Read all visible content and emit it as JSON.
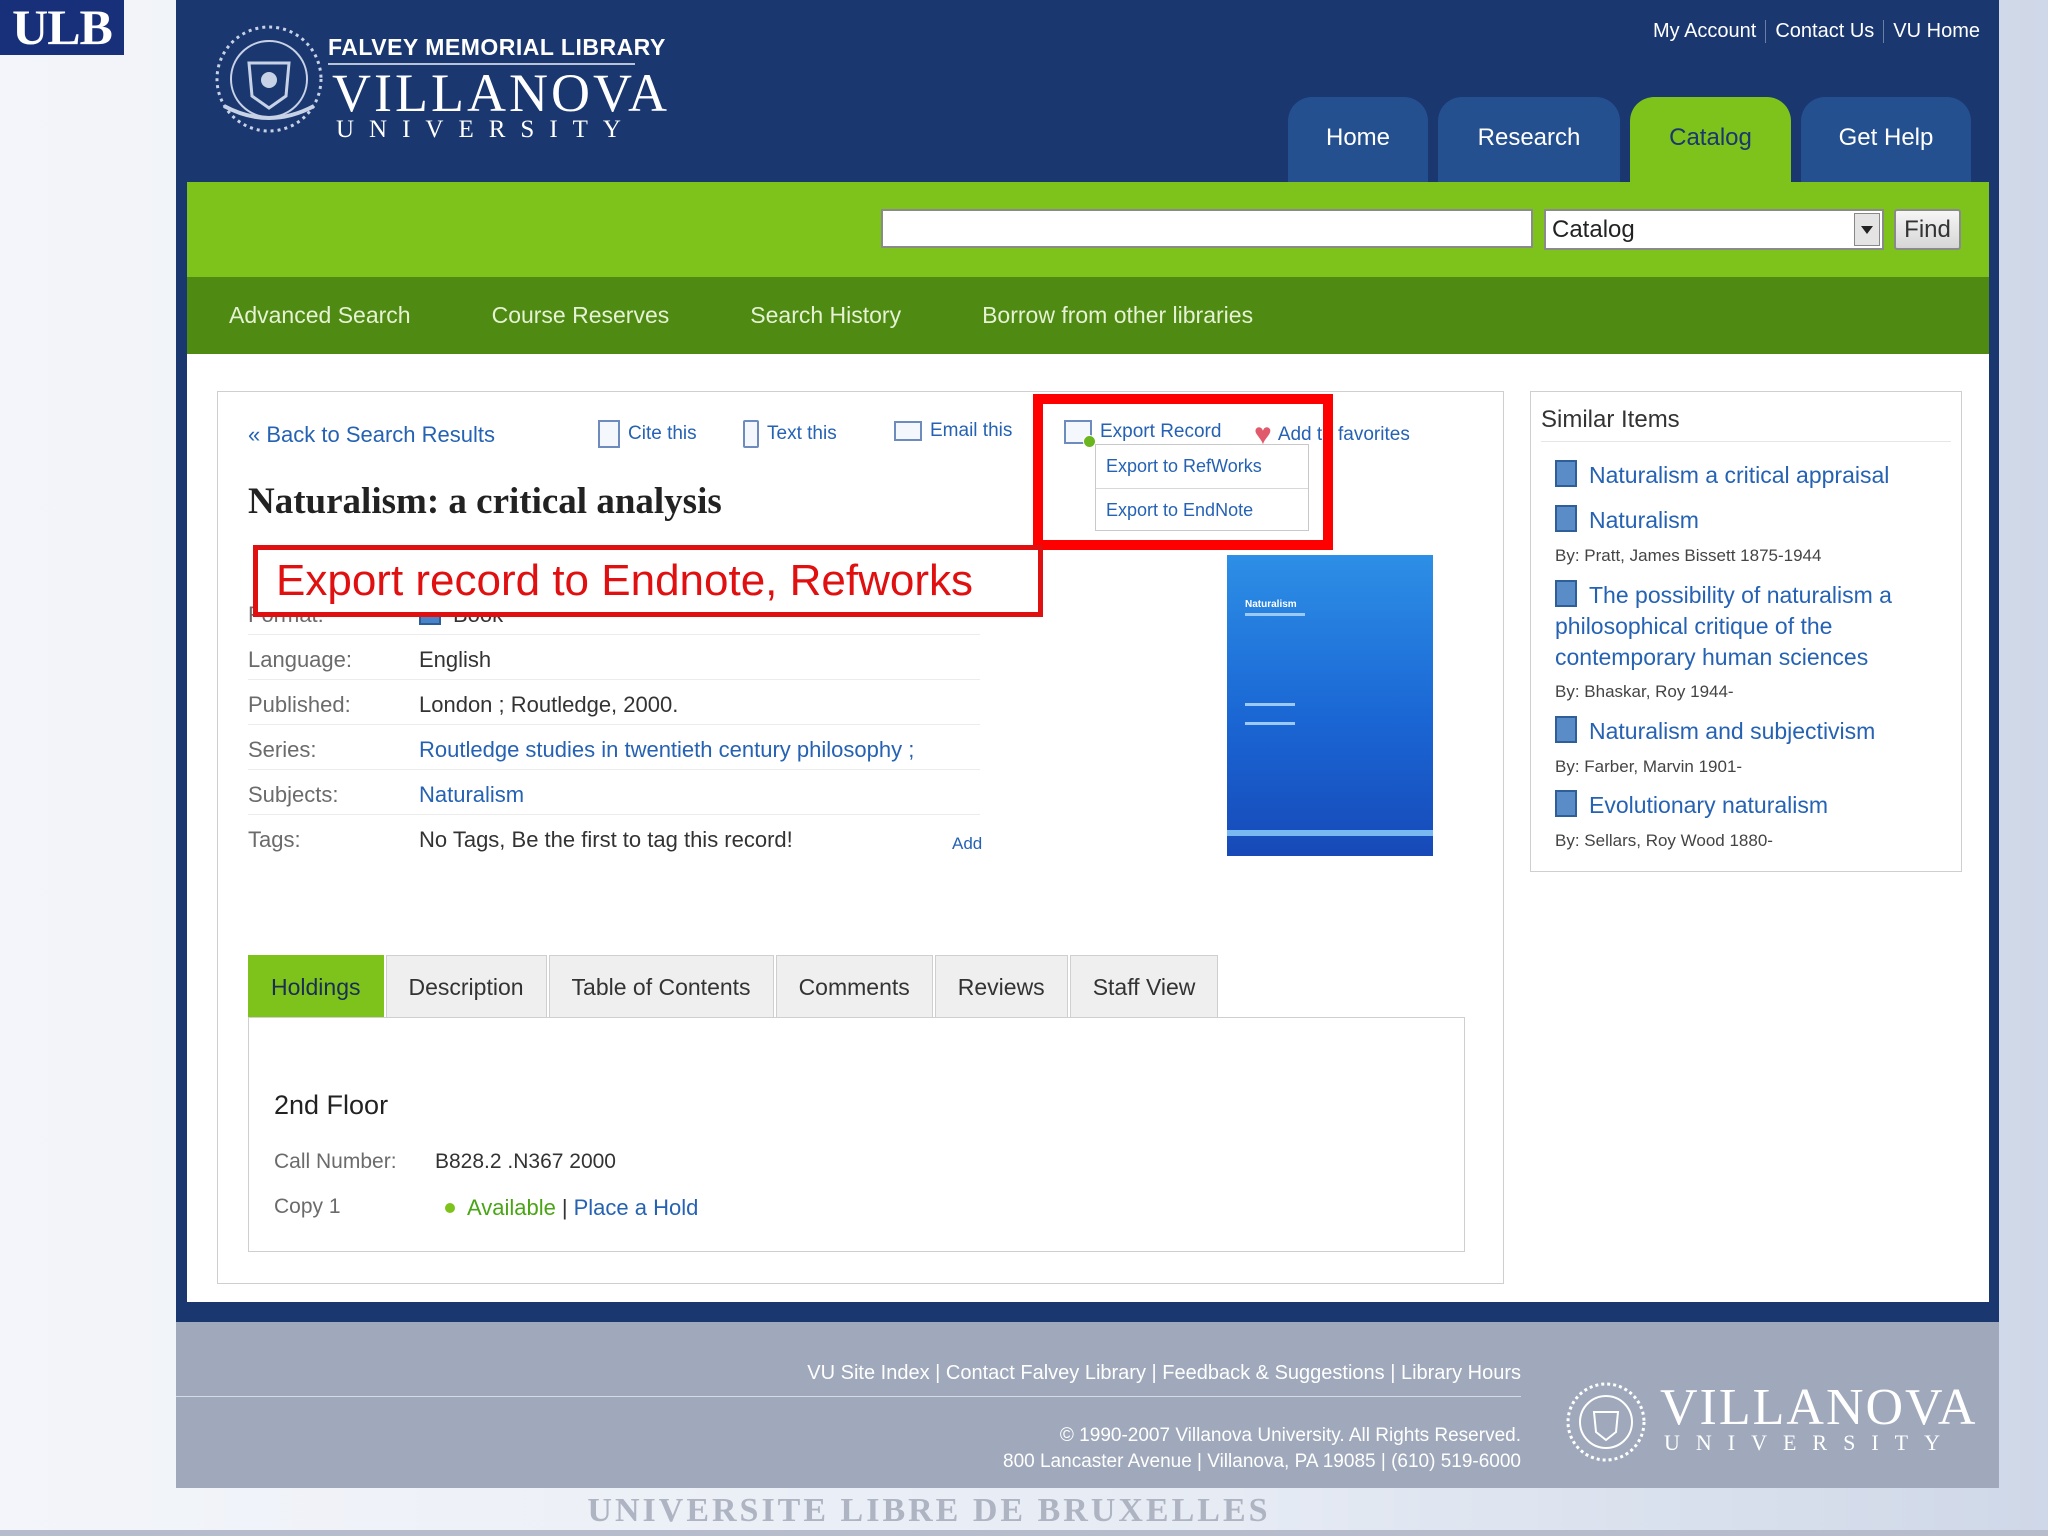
{
  "slide": {
    "logo": "ULB",
    "footer_text": "UNIVERSITE LIBRE DE BRUXELLES"
  },
  "header": {
    "library_name": "FALVEY MEMORIAL LIBRARY",
    "university_name": "VILLANOVA",
    "university_sub": "UNIVERSITY",
    "utility_links": [
      "My Account",
      "Contact Us",
      "VU Home"
    ],
    "tabs": [
      {
        "label": "Home",
        "active": false
      },
      {
        "label": "Research",
        "active": false
      },
      {
        "label": "Catalog",
        "active": true
      },
      {
        "label": "Get Help",
        "active": false
      }
    ]
  },
  "search": {
    "query": "",
    "scope": "Catalog",
    "find_label": "Find"
  },
  "sub_nav": [
    "Advanced Search",
    "Course Reserves",
    "Search History",
    "Borrow from other libraries"
  ],
  "record": {
    "back_link": "« Back to Search Results",
    "tools": {
      "cite": "Cite this",
      "text": "Text this",
      "email": "Email this",
      "export": "Export Record",
      "favorites": "Add to favorites"
    },
    "export_menu": [
      "Export to RefWorks",
      "Export to EndNote"
    ],
    "title": "Naturalism: a critical analysis",
    "fields": {
      "format_label": "Format:",
      "format_value": "Book",
      "language_label": "Language:",
      "language_value": "English",
      "published_label": "Published:",
      "published_value": "London ; Routledge, 2000.",
      "series_label": "Series:",
      "series_value": "Routledge studies in twentieth century philosophy ;",
      "subjects_label": "Subjects:",
      "subjects_value": "Naturalism",
      "tags_label": "Tags:",
      "tags_value": "No Tags, Be the first to tag this record!",
      "add_tag": "Add"
    },
    "cover_title": "Naturalism"
  },
  "detail_tabs": [
    {
      "label": "Holdings",
      "active": true
    },
    {
      "label": "Description",
      "active": false
    },
    {
      "label": "Table of Contents",
      "active": false
    },
    {
      "label": "Comments",
      "active": false
    },
    {
      "label": "Reviews",
      "active": false
    },
    {
      "label": "Staff View",
      "active": false
    }
  ],
  "holdings": {
    "location": "2nd Floor",
    "call_number_label": "Call Number:",
    "call_number": "B828.2 .N367 2000",
    "copy_label": "Copy 1",
    "status": "Available",
    "separator": "|",
    "hold_link": "Place a Hold",
    "status_color": "#4aa515"
  },
  "similar": {
    "title": "Similar Items",
    "items": [
      {
        "title": "Naturalism a critical appraisal",
        "author": ""
      },
      {
        "title": "Naturalism",
        "author": "By: Pratt, James Bissett 1875-1944"
      },
      {
        "title": "The possibility of naturalism a philosophical critique of the contemporary human sciences",
        "author": "By: Bhaskar, Roy 1944-"
      },
      {
        "title": "Naturalism and subjectivism",
        "author": "By: Farber, Marvin 1901-"
      },
      {
        "title": "Evolutionary naturalism",
        "author": "By: Sellars, Roy Wood 1880-"
      }
    ]
  },
  "annotation": {
    "text": "Export record to Endnote, Refworks",
    "color": "#e01010"
  },
  "footer": {
    "links": "VU Site Index | Contact Falvey Library | Feedback & Suggestions | Library Hours",
    "copyright": "© 1990-2007 Villanova University. All Rights Reserved.",
    "address": "800 Lancaster Avenue | Villanova, PA 19085 | (610) 519-6000",
    "university_name": "VILLANOVA",
    "university_sub": "UNIVERSITY"
  },
  "colors": {
    "navy": "#1a3770",
    "green": "#7dc31b",
    "dark_green": "#4f8a12",
    "link": "#2562b4"
  }
}
